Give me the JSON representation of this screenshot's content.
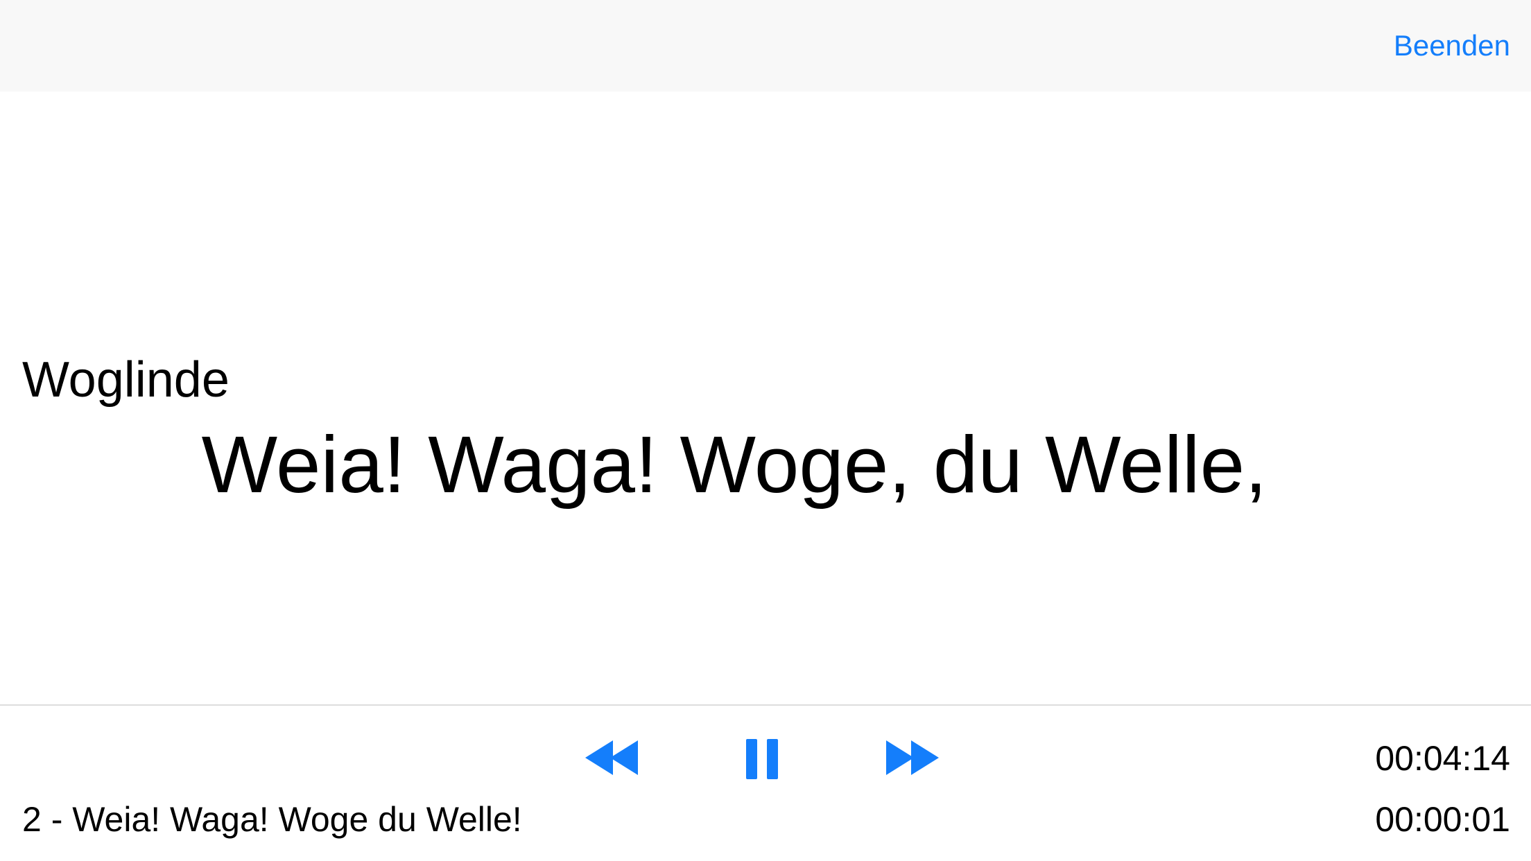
{
  "navigation": {
    "done_label": "Beenden"
  },
  "content": {
    "speaker": "Woglinde",
    "lyric": "Weia! Waga! Woge, du Welle,"
  },
  "player": {
    "controls": {
      "rewind_icon": "rewind-icon",
      "pause_icon": "pause-icon",
      "forward_icon": "fast-forward-icon"
    },
    "track_title": "2 - Weia! Waga! Woge du Welle!",
    "time_total": "00:04:14",
    "time_elapsed": "00:00:01"
  },
  "colors": {
    "accent": "#147efb",
    "nav_background": "#f8f8f8",
    "divider": "#dddddd"
  }
}
